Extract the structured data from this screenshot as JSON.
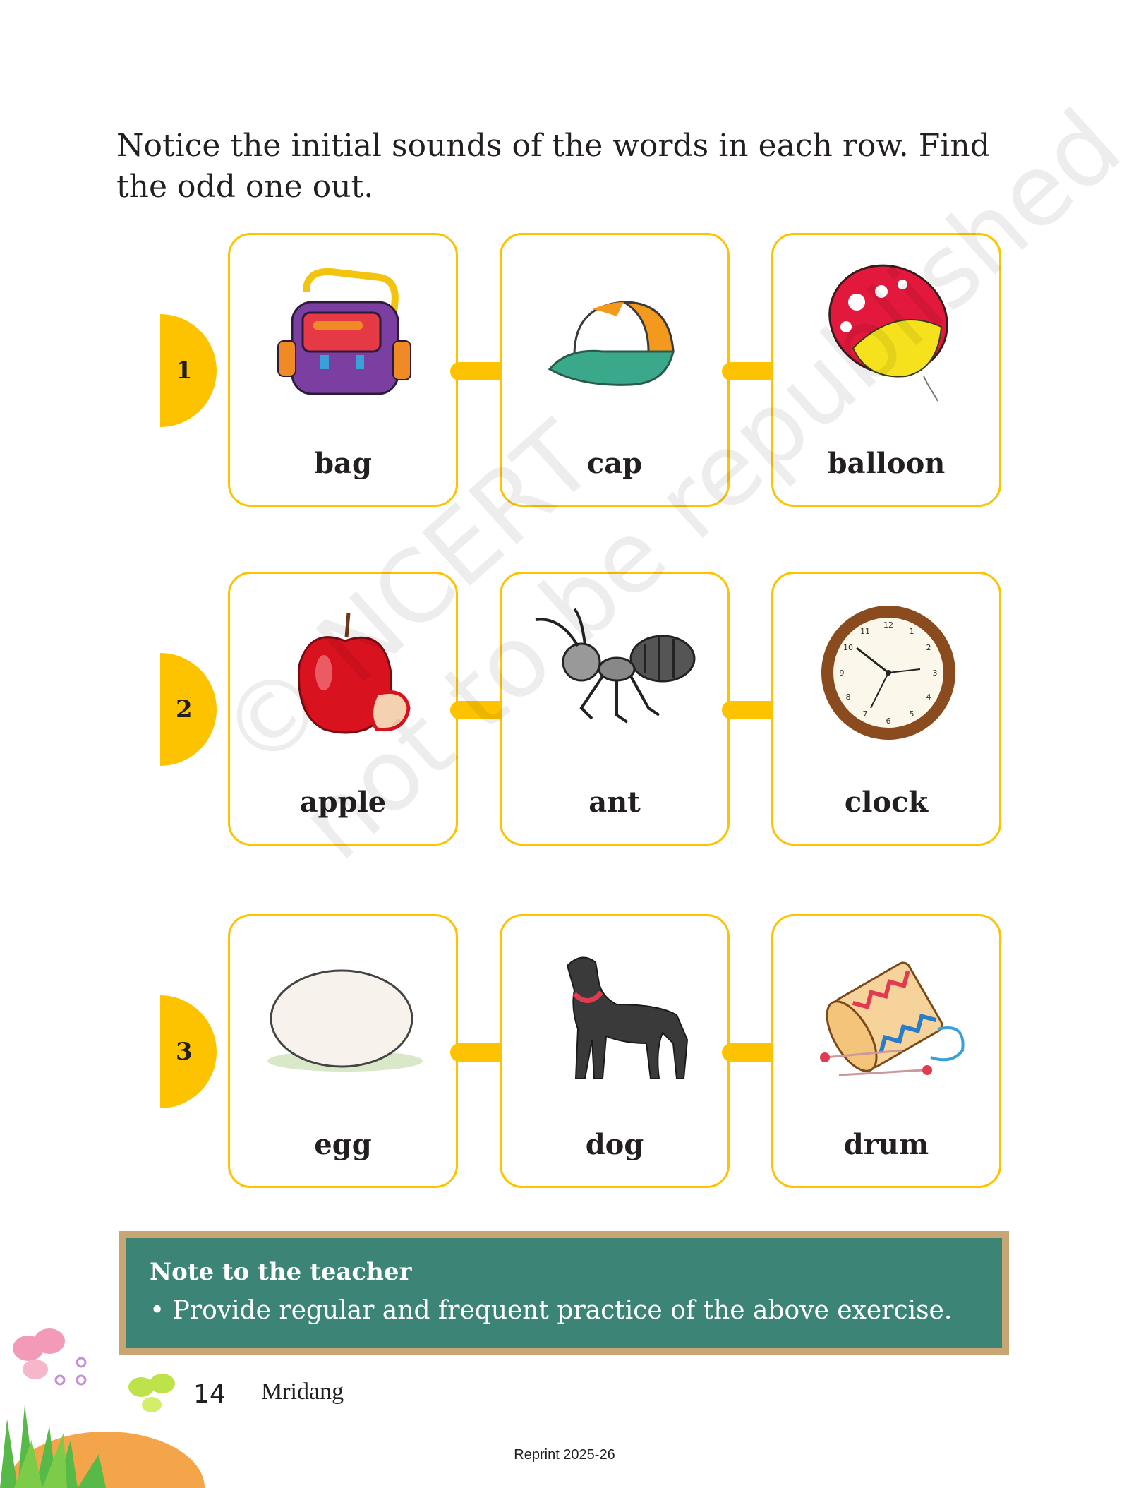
{
  "instruction": "Notice the initial sounds of the words in each row. Find the odd one out.",
  "rows": [
    {
      "number": "1",
      "items": [
        {
          "word": "bag",
          "icon": "bag-icon"
        },
        {
          "word": "cap",
          "icon": "cap-icon"
        },
        {
          "word": "balloon",
          "icon": "balloon-icon"
        }
      ]
    },
    {
      "number": "2",
      "items": [
        {
          "word": "apple",
          "icon": "apple-icon"
        },
        {
          "word": "ant",
          "icon": "ant-icon"
        },
        {
          "word": "clock",
          "icon": "clock-icon"
        }
      ]
    },
    {
      "number": "3",
      "items": [
        {
          "word": "egg",
          "icon": "egg-icon"
        },
        {
          "word": "dog",
          "icon": "dog-icon"
        },
        {
          "word": "drum",
          "icon": "drum-icon"
        }
      ]
    }
  ],
  "note": {
    "title": "Note to the teacher",
    "bullet": "• Provide regular and frequent practice of the above exercise."
  },
  "footer": {
    "page_number": "14",
    "book_title": "Mridang",
    "reprint": "Reprint 2025-26"
  },
  "watermark": [
    "© NCERT",
    "not to be republished"
  ],
  "colors": {
    "accent": "#fdc300",
    "note_bg": "#3c8576",
    "note_border": "#c7a673"
  }
}
